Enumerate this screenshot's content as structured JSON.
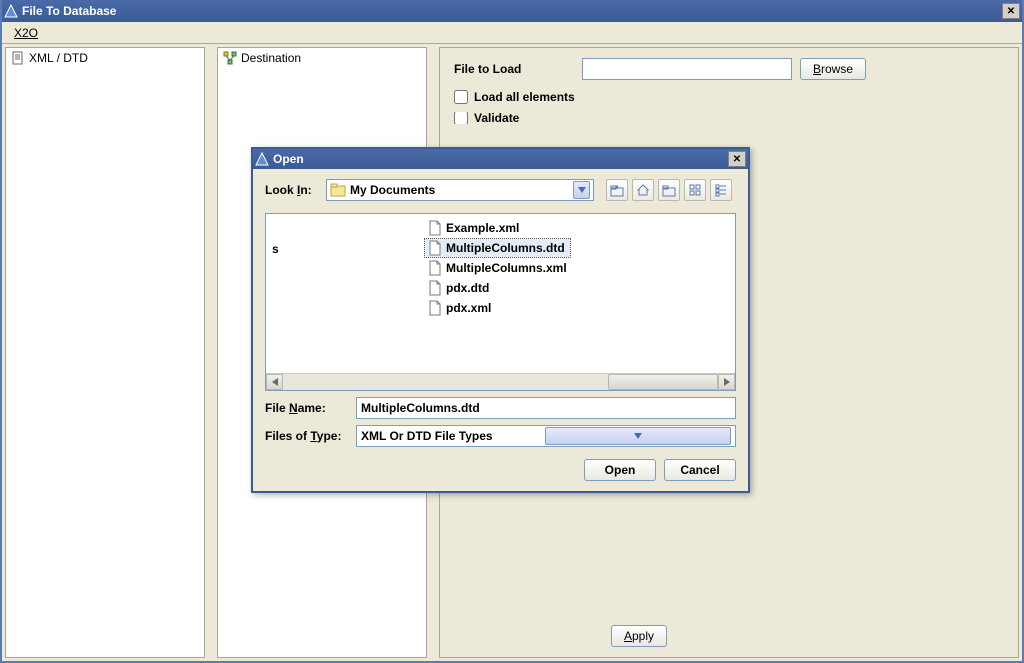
{
  "window": {
    "title": "File To Database",
    "menu": {
      "x2o": "X2O"
    },
    "close_glyph": "✕"
  },
  "panels": {
    "left": {
      "label": "XML / DTD"
    },
    "middle": {
      "label": "Destination"
    }
  },
  "form": {
    "file_to_load_label": "File to Load",
    "file_to_load_value": "",
    "browse_label": "Browse",
    "load_all_label": "Load all elements",
    "validate_label": "Validate",
    "apply_label": "Apply"
  },
  "dialog": {
    "title": "Open",
    "look_in_label": "Look In:",
    "look_in_value": "My Documents",
    "files": {
      "stray": "s",
      "list": [
        "Example.xml",
        "MultipleColumns.dtd",
        "MultipleColumns.xml",
        "pdx.dtd",
        "pdx.xml"
      ],
      "selected_index": 1
    },
    "file_name_label": "File Name:",
    "file_name_value": "MultipleColumns.dtd",
    "files_of_type_label": "Files of Type:",
    "files_of_type_value": "XML Or DTD File Types",
    "open_label": "Open",
    "cancel_label": "Cancel"
  }
}
